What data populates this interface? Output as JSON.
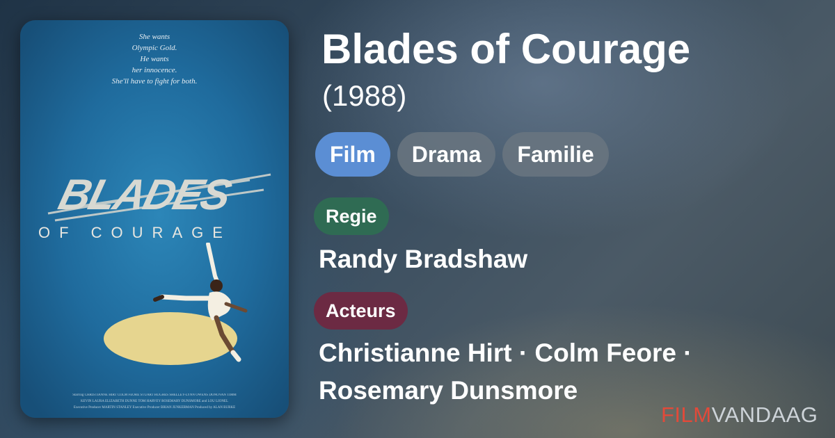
{
  "poster": {
    "tagline": [
      "She wants",
      "Olympic Gold.",
      "He wants",
      "her innocence.",
      "She'll have to fight for both."
    ],
    "title_main": "BLADES",
    "title_sub": "OF COURAGE",
    "credits": [
      "Starring CHRISTIANNE HIRT  COLM FEORE  STUART HUGHES  SHELLEY-LYNN OWENS  DONOVAN TIMM",
      "KEVIN LAURA  ELIZABETH DUNNE  TOM HARVEY  ROSEMARY DUNSMORE  and LOU LIONEL",
      "Executive Producer  MARTIN STANLEY   Executive Producer  BRIAN JUNKERMAN   Produced by ALAN BURKE"
    ]
  },
  "movie": {
    "title": "Blades of Courage",
    "year": "(1988)"
  },
  "genres": [
    "Film",
    "Drama",
    "Familie"
  ],
  "director_section": {
    "label": "Regie",
    "name": "Randy Bradshaw"
  },
  "cast_section": {
    "label": "Acteurs",
    "line1": "Christianne Hirt · Colm Feore ·",
    "line2": "Rosemary Dunsmore"
  },
  "brand": {
    "part1": "FILM",
    "part2": "VANDAAG"
  },
  "colors": {
    "genre_primary": "#5b8ed4",
    "genre_secondary": "#6a7680",
    "director_label": "#2f6b53",
    "cast_label": "#6c2a43",
    "brand_accent": "#e24a3a"
  }
}
